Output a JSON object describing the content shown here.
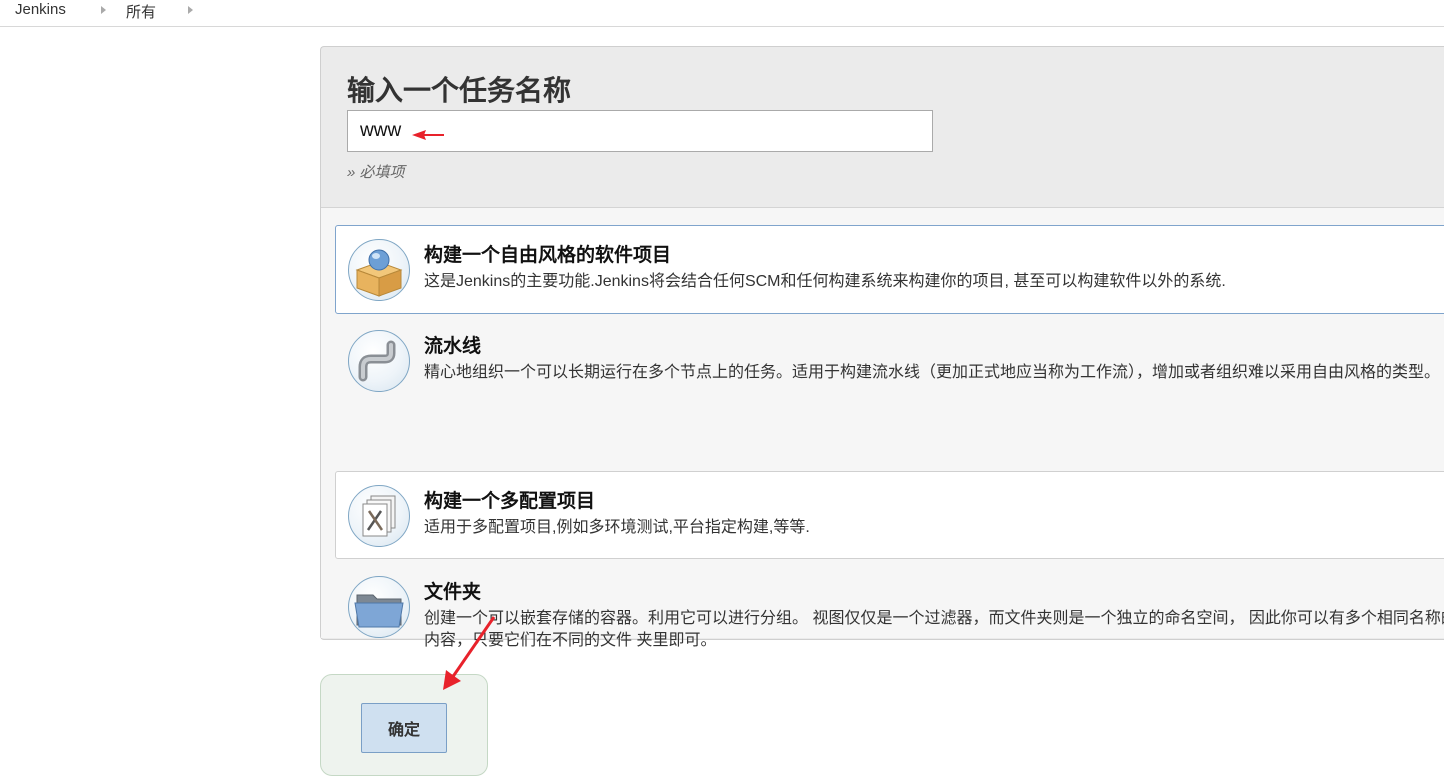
{
  "breadcrumb": {
    "items": [
      {
        "label": "Jenkins"
      },
      {
        "label": "所有"
      }
    ]
  },
  "form": {
    "title": "输入一个任务名称",
    "item_name_value": "www",
    "required_hint": "» 必填项"
  },
  "item_types": [
    {
      "label": "构建一个自由风格的软件项目",
      "description": "这是Jenkins的主要功能.Jenkins将会结合任何SCM和任何构建系统来构建你的项目, 甚至可以构建软件以外的系统.",
      "icon": "freestyle-project-icon",
      "selected": true
    },
    {
      "label": "流水线",
      "description": "精心地组织一个可以长期运行在多个节点上的任务。适用于构建流水线（更加正式地应当称为工作流），增加或者组织难以采用自由风格的类型。",
      "icon": "pipeline-icon",
      "selected": false
    },
    {
      "label": "构建一个多配置项目",
      "description": "适用于多配置项目,例如多环境测试,平台指定构建,等等.",
      "icon": "multi-configuration-icon",
      "selected": false
    },
    {
      "label": "文件夹",
      "description": "创建一个可以嵌套存储的容器。利用它可以进行分组。 视图仅仅是一个过滤器，而文件夹则是一个独立的命名空间， 因此你可以有多个相同名称的内容，只要它们在不同的文件 夹里即可。",
      "icon": "folder-icon",
      "selected": false
    }
  ],
  "ok_button": {
    "label": "确定"
  },
  "colors": {
    "annotation_arrow": "#e8222b",
    "selected_border": "#7fa4cc",
    "ok_button_bg": "#cfe0f0"
  }
}
